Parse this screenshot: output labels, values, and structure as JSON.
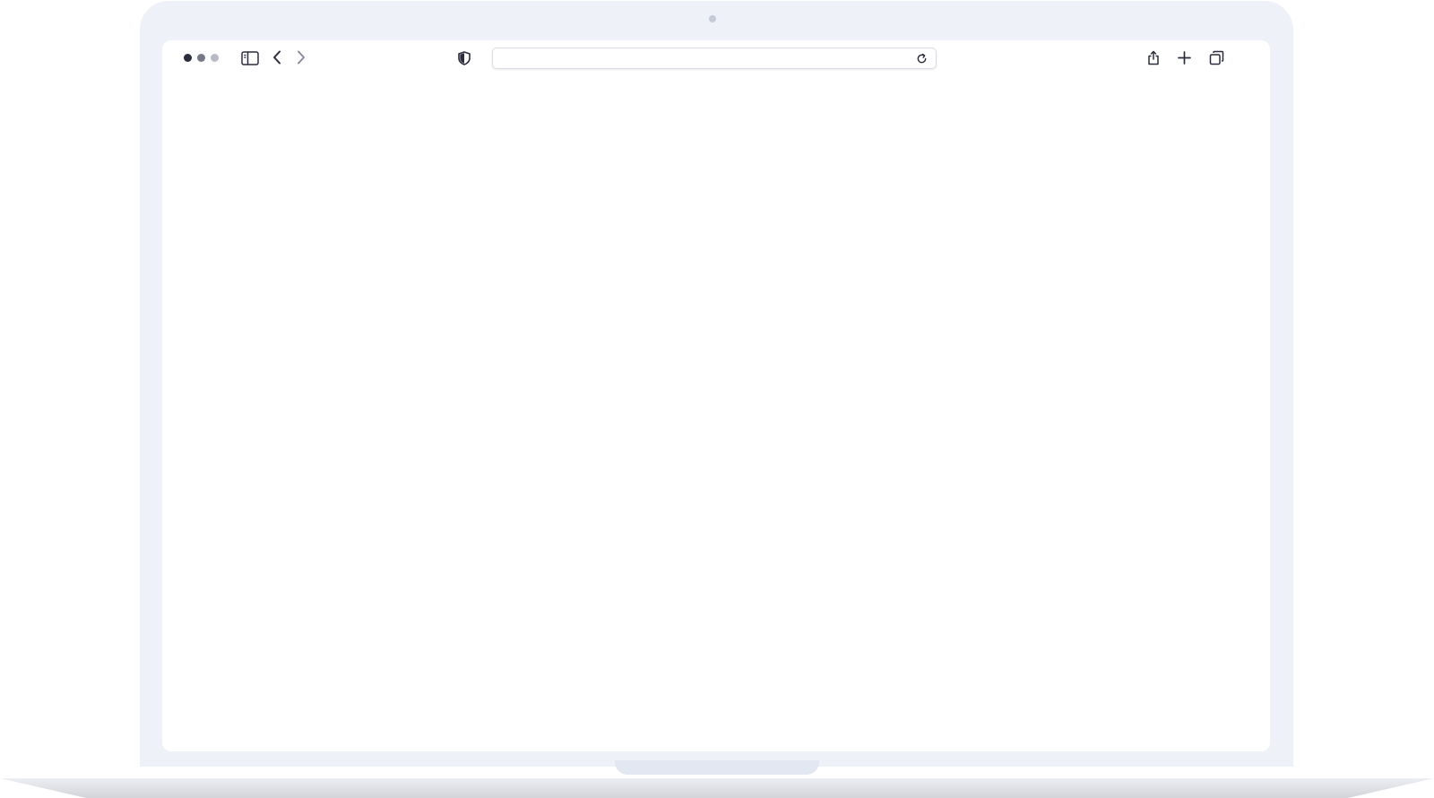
{
  "window": {
    "traffic_lights": [
      "close",
      "minimize",
      "zoom"
    ]
  },
  "toolbar": {
    "icons": {
      "sidebar": "sidebar-toggle-icon",
      "back": "chevron-left-icon",
      "forward": "chevron-right-icon",
      "privacy": "shield-icon",
      "reload": "reload-icon",
      "share": "share-icon",
      "new_tab": "plus-icon",
      "tabs": "tab-overview-icon"
    }
  },
  "address_bar": {
    "value": "",
    "placeholder": ""
  },
  "colors": {
    "bezel": "#eef1f8",
    "icon_dark": "#2b2d3d",
    "icon_muted": "#8a8d9a"
  }
}
